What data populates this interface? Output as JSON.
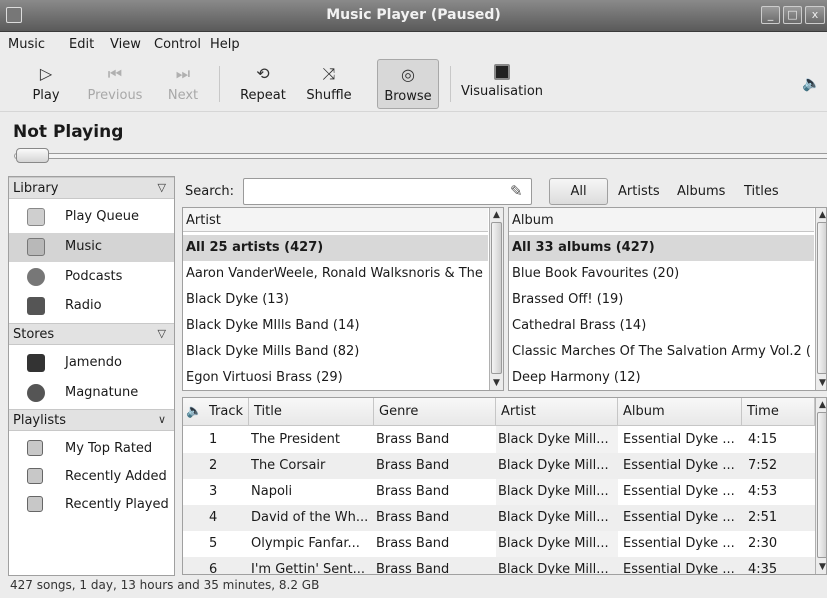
{
  "window": {
    "title": "Music Player (Paused)",
    "minimize": "_",
    "maximize": "□",
    "close": "x"
  },
  "menu": [
    "Music",
    "Edit",
    "View",
    "Control",
    "Help"
  ],
  "toolbar": {
    "play": "Play",
    "previous": "Previous",
    "next": "Next",
    "repeat": "Repeat",
    "shuffle": "Shuffle",
    "browse": "Browse",
    "visualisation": "Visualisation"
  },
  "now_playing": "Not Playing",
  "sidebar": {
    "library_header": "Library",
    "library": [
      {
        "label": "Play Queue",
        "icon": "play-queue-icon"
      },
      {
        "label": "Music",
        "icon": "music-library-icon",
        "selected": true
      },
      {
        "label": "Podcasts",
        "icon": "podcast-icon"
      },
      {
        "label": "Radio",
        "icon": "radio-icon"
      }
    ],
    "stores_header": "Stores",
    "stores": [
      {
        "label": "Jamendo",
        "icon": "jamendo-icon"
      },
      {
        "label": "Magnatune",
        "icon": "magnatune-icon"
      }
    ],
    "playlists_header": "Playlists",
    "playlists": [
      {
        "label": "My Top Rated",
        "icon": "smart-playlist-icon"
      },
      {
        "label": "Recently Added",
        "icon": "smart-playlist-icon"
      },
      {
        "label": "Recently Played",
        "icon": "smart-playlist-icon"
      }
    ]
  },
  "search": {
    "label": "Search:",
    "value": "",
    "filters": [
      "All",
      "Artists",
      "Albums",
      "Titles"
    ]
  },
  "artist_pane": {
    "header": "Artist",
    "rows": [
      "All 25 artists (427)",
      "Aaron VanderWeele, Ronald Walksnoris & The",
      "Black Dyke (13)",
      "Black Dyke MIlls Band (14)",
      "Black Dyke Mills Band (82)",
      "Egon Virtuosi Brass (29)"
    ]
  },
  "album_pane": {
    "header": "Album",
    "rows": [
      "All 33 albums (427)",
      "Blue Book Favourites (20)",
      "Brassed Off! (19)",
      "Cathedral Brass (14)",
      "Classic Marches Of The Salvation Army Vol.2 (",
      "Deep Harmony (12)"
    ]
  },
  "tracks": {
    "columns": [
      "Track",
      "Title",
      "Genre",
      "Artist",
      "Album",
      "Time"
    ],
    "rows": [
      {
        "track": "1",
        "title": "The President",
        "genre": "Brass Band",
        "artist": "Black Dyke Mill...",
        "album": "Essential Dyke ...",
        "time": "4:15"
      },
      {
        "track": "2",
        "title": "The Corsair",
        "genre": "Brass Band",
        "artist": "Black Dyke Mill...",
        "album": "Essential Dyke ...",
        "time": "7:52"
      },
      {
        "track": "3",
        "title": "Napoli",
        "genre": "Brass Band",
        "artist": "Black Dyke Mill...",
        "album": "Essential Dyke ...",
        "time": "4:53"
      },
      {
        "track": "4",
        "title": "David of the Wh...",
        "genre": "Brass Band",
        "artist": "Black Dyke Mill...",
        "album": "Essential Dyke ...",
        "time": "2:51"
      },
      {
        "track": "5",
        "title": "Olympic Fanfar...",
        "genre": "Brass Band",
        "artist": "Black Dyke Mill...",
        "album": "Essential Dyke ...",
        "time": "2:30"
      },
      {
        "track": "6",
        "title": "I'm Gettin' Sent...",
        "genre": "Brass Band",
        "artist": "Black Dyke Mill...",
        "album": "Essential Dyke ...",
        "time": "4:35"
      }
    ]
  },
  "status": "427 songs, 1 day, 13 hours and 35 minutes, 8.2 GB"
}
